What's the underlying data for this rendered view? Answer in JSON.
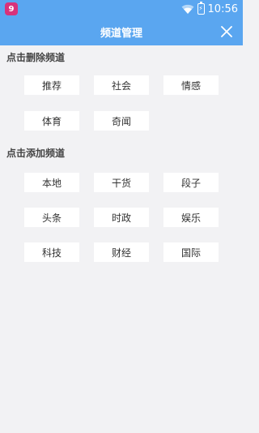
{
  "status_bar": {
    "app_badge": "9",
    "time": "10:56",
    "battery_glyph": "⚡"
  },
  "header": {
    "title": "频道管理",
    "close_icon": "close-icon"
  },
  "my_channels": {
    "title": "点击删除频道",
    "items": [
      "推荐",
      "社会",
      "情感",
      "体育",
      "奇闻"
    ]
  },
  "more_channels": {
    "title": "点击添加频道",
    "items": [
      "本地",
      "干货",
      "段子",
      "头条",
      "时政",
      "娱乐",
      "科技",
      "财经",
      "国际"
    ]
  },
  "colors": {
    "accent": "#5aa6f0",
    "background": "#f2f2f4",
    "chip": "#ffffff"
  }
}
